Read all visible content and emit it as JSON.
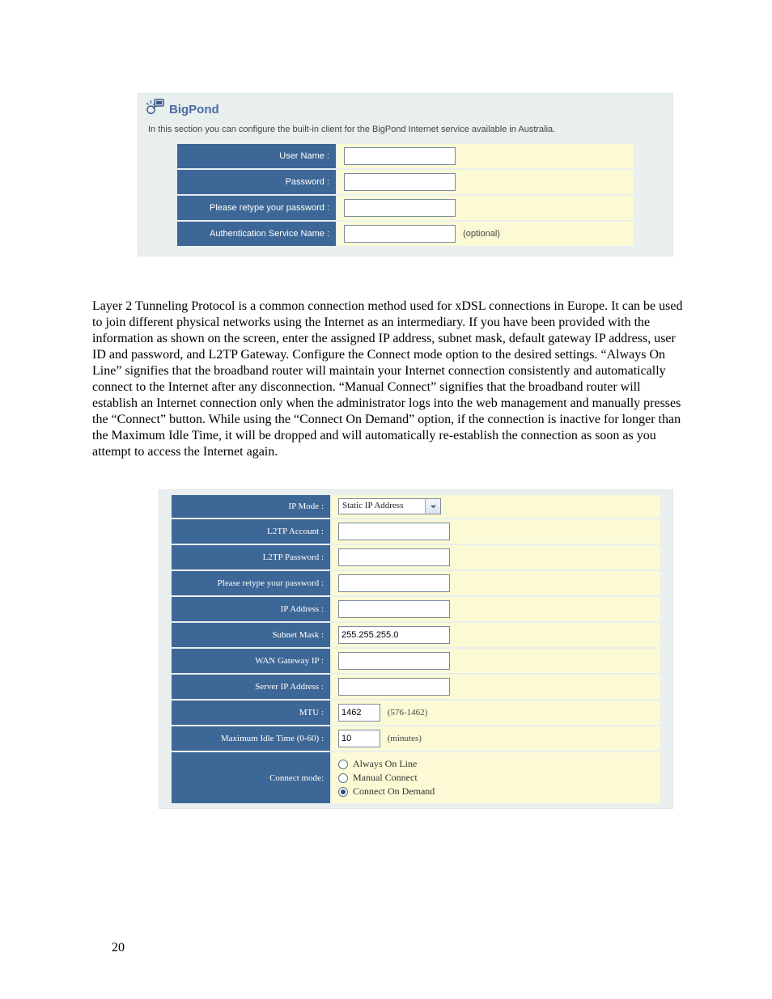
{
  "bigpond": {
    "brand": "BigPond",
    "description": "In this section you can configure the built-in client for the BigPond Internet service available in Australia.",
    "rows": {
      "username_label": "User Name :",
      "password_label": "Password :",
      "retype_label": "Please retype your password :",
      "auth_label": "Authentication Service Name :",
      "auth_hint": "(optional)"
    },
    "values": {
      "username": "",
      "password": "",
      "retype": "",
      "auth": ""
    }
  },
  "paragraph": "Layer 2 Tunneling Protocol is a common connection method used for xDSL connections in Europe. It can be used to join different physical networks using the Internet as an intermediary. If you have been provided with the information as shown on the screen, enter the assigned IP address, subnet mask, default gateway IP address, user ID and password, and L2TP Gateway. Configure the Connect mode option to the desired settings. “Always On Line” signifies that the broadband router will maintain your Internet connection consistently and automatically connect to the Internet after any disconnection. “Manual Connect” signifies that the broadband router will establish an Internet connection only when the administrator logs into the web management and manually presses the “Connect” button. While using the “Connect On Demand” option, if the connection is inactive for longer than the Maximum Idle Time, it will be dropped and will automatically re-establish the connection as soon as you attempt to access the Internet again.",
  "l2tp": {
    "labels": {
      "ip_mode": "IP Mode :",
      "account": "L2TP Account :",
      "password": "L2TP Password :",
      "retype": "Please retype your password :",
      "ip_address": "IP Address :",
      "subnet": "Subnet Mask :",
      "wan_gateway": "WAN Gateway IP :",
      "server_ip": "Server IP Address :",
      "mtu": "MTU :",
      "max_idle": "Maximum Idle Time (0-60) :",
      "connect_mode": "Connect mode:"
    },
    "values": {
      "ip_mode": "Static IP Address",
      "account": "",
      "password": "",
      "retype": "",
      "ip_address": "",
      "subnet": "255.255.255.0",
      "wan_gateway": "",
      "server_ip": "",
      "mtu": "1462",
      "max_idle": "10"
    },
    "hints": {
      "mtu": "(576-1462)",
      "max_idle": "(minutes)"
    },
    "connect_options": {
      "always": "Always On Line",
      "manual": "Manual Connect",
      "demand": "Connect On Demand",
      "selected": "demand"
    }
  },
  "pageNumber": "20"
}
